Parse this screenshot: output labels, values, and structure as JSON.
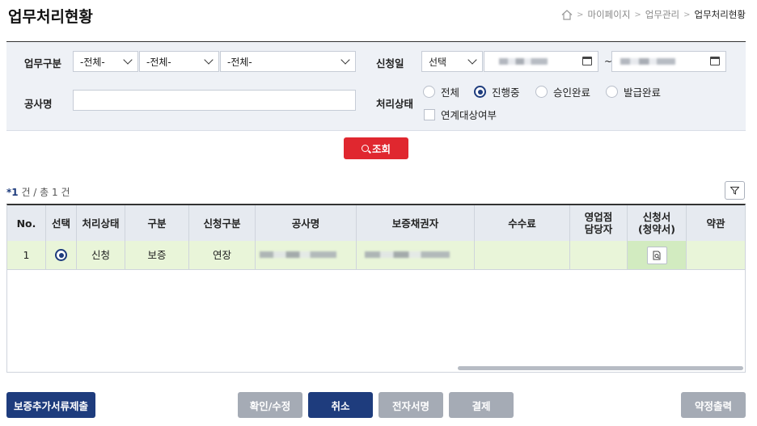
{
  "page_title": "업무처리현황",
  "breadcrumb": {
    "items": [
      "마이페이지",
      "업무관리"
    ],
    "current": "업무처리현황"
  },
  "search": {
    "work_type_label": "업무구분",
    "work_type_selects": [
      "-전체-",
      "-전체-",
      "-전체-"
    ],
    "apply_date_label": "신청일",
    "apply_date_select": "선택",
    "date_separator": "~",
    "project_label": "공사명",
    "project_value": "",
    "status_label": "처리상태",
    "status_options": [
      "전체",
      "진행중",
      "승인완료",
      "발급완료"
    ],
    "status_selected": "진행중",
    "linked_label": "연계대상여부",
    "search_button": "조회"
  },
  "result": {
    "count_num": "1",
    "count_rest": " 건 / 총 1 건",
    "count_prefix": "*"
  },
  "table": {
    "headers": [
      "No.",
      "선택",
      "처리상태",
      "구분",
      "신청구분",
      "공사명",
      "보증채권자",
      "수수료",
      "영업점\n담당자",
      "신청서\n(청약서)",
      "약관"
    ],
    "rows": [
      {
        "no": "1",
        "status": "신청",
        "type": "보증",
        "apply_type": "연장",
        "fee": ""
      }
    ]
  },
  "buttons": {
    "submit_docs": "보증추가서류제출",
    "confirm_edit": "확인/수정",
    "cancel": "취소",
    "e_sign": "전자서명",
    "payment": "결제",
    "print_agreement": "약정출력"
  },
  "colors": {
    "primary": "#1e3c7d",
    "search_red": "#e0272f",
    "row_highlight": "#e9f5d9",
    "disabled": "#a5abb5"
  }
}
